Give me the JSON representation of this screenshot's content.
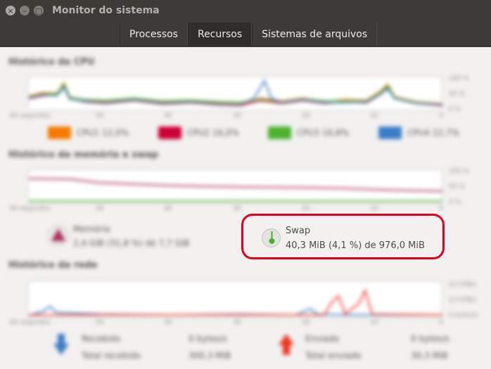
{
  "window": {
    "title": "Monitor do sistema"
  },
  "tabs": [
    {
      "label": "Processos"
    },
    {
      "label": "Recursos"
    },
    {
      "label": "Sistemas de arquivos"
    }
  ],
  "colors": {
    "cpu1": "#f57900",
    "cpu2": "#cc0033",
    "cpu3": "#4bb12e",
    "cpu4": "#3b7cc6",
    "memory": "#ab2a5e",
    "swap": "#4bae2e",
    "received": "#3b7cc6",
    "sent": "#ef3422",
    "highlight": "#e1001d"
  },
  "cpu": {
    "title": "Histórico da CPU",
    "pct_labels": [
      "100 %",
      "50 %",
      "0 %"
    ],
    "time_labels": [
      "60 segundos",
      "50",
      "40",
      "30",
      "20",
      "10",
      "0"
    ],
    "legend": [
      {
        "label": "CPU1 12,0%"
      },
      {
        "label": "CPU2 16,0%"
      },
      {
        "label": "CPU3 16,8%"
      },
      {
        "label": "CPU4 22,7%"
      }
    ]
  },
  "memory": {
    "title": "Histórico da memória e swap",
    "pct_labels": [
      "100 %",
      "50 %",
      "0 %"
    ],
    "time_labels": [
      "60 segundos",
      "50",
      "40",
      "30",
      "20",
      "10",
      "0"
    ],
    "mem_label": "Memória",
    "mem_value": "2,4 GiB (31,8 %) de 7,7 GiB",
    "swap_icon": "swap-pie-icon",
    "swap_label": "Swap",
    "swap_value": "40,3 MiB (4,1 %) de 976,0 MiB",
    "swap_fraction": 0.041
  },
  "network": {
    "title": "Histórico da rede",
    "rate_labels": [
      "4,0 KiB/s",
      "2,0 KiB/s",
      "0 bytes/s"
    ],
    "time_labels": [
      "60 segundos",
      "50",
      "40",
      "30",
      "20",
      "10",
      "0"
    ],
    "received_label": "Recebido",
    "received_rate": "0 bytes/s",
    "total_received_label": "Total recebido",
    "total_received": "300,3 MiB",
    "sent_label": "Enviado",
    "sent_rate": "0 bytes/s",
    "total_sent_label": "Total enviado",
    "total_sent": "30,3 MiB"
  }
}
